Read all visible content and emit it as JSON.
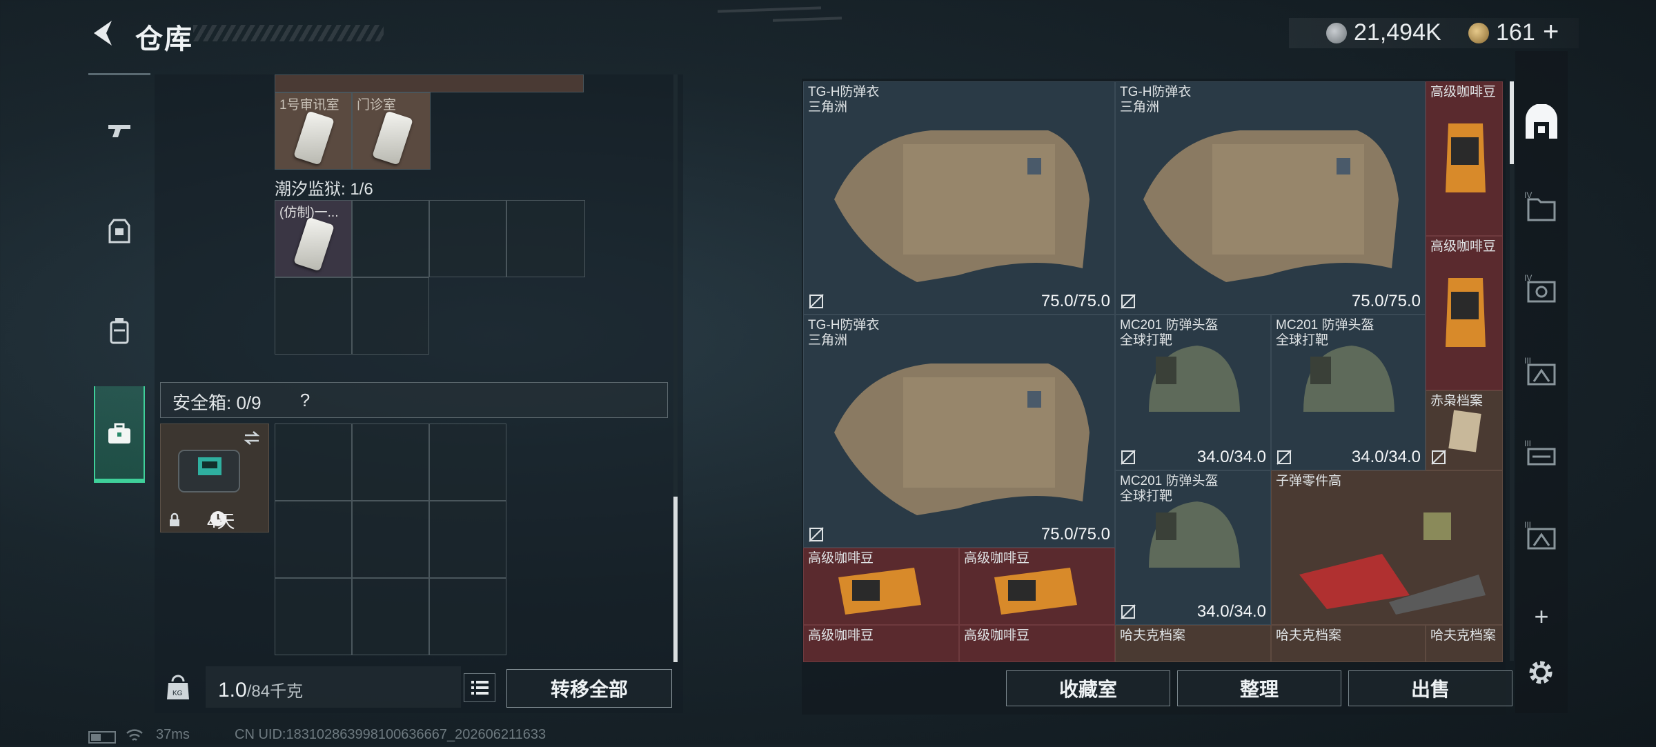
{
  "header": {
    "title": "仓库",
    "currency_1": "21,494K",
    "currency_2": "161",
    "plus": "+"
  },
  "storage": {
    "top_cells": [
      {
        "label": "1号审讯室"
      },
      {
        "label": "门诊室"
      }
    ],
    "prison_label": "潮汐监狱: 1/6",
    "prison_item": "(仿制)一...",
    "safe_label": "安全箱: 0/9",
    "safe_help": "?",
    "safe_time": "4天"
  },
  "bottom_left": {
    "weight": "1.0",
    "weight_max": "/84千克",
    "transfer_all": "转移全部"
  },
  "status": {
    "ping": "37ms",
    "uid": "CN UID:18310286399810063666​7_202606211633"
  },
  "stash": {
    "items": [
      {
        "name": "TG-H防弹衣",
        "sub": "三角洲",
        "dura": "75.0/75.0"
      },
      {
        "name": "TG-H防弹衣",
        "sub": "三角洲",
        "dura": "75.0/75.0"
      },
      {
        "name": "高级咖啡豆"
      },
      {
        "name": "高级咖啡豆"
      },
      {
        "name": "TG-H防弹衣",
        "sub": "三角洲",
        "dura": "75.0/75.0"
      },
      {
        "name": "MC201 防弹头盔",
        "sub": "全球打靶",
        "dura": "34.0/34.0"
      },
      {
        "name": "MC201 防弹头盔",
        "sub": "全球打靶",
        "dura": "34.0/34.0"
      },
      {
        "name": "赤枭档案"
      },
      {
        "name": "MC201 防弹头盔",
        "sub": "全球打靶",
        "dura": "34.0/34.0"
      },
      {
        "name": "子弹零件高"
      },
      {
        "name": "高级咖啡豆"
      },
      {
        "name": "高级咖啡豆"
      },
      {
        "name": "高级咖啡豆"
      },
      {
        "name": "高级咖啡豆"
      },
      {
        "name": "哈夫克档案"
      },
      {
        "name": "哈夫克档案"
      },
      {
        "name": "哈夫克档案"
      }
    ]
  },
  "sidebar_right": {
    "plus": "+",
    "tabs": [
      "home",
      "IV",
      "IV",
      "III",
      "III",
      "III"
    ]
  },
  "bottom_right": {
    "collection": "收藏室",
    "sort": "整理",
    "sell": "出售"
  },
  "colors": {
    "accent_green": "#3fd09a",
    "cell_blue": "#233340",
    "cell_red": "#5a2a2e",
    "cell_brown": "#4a3a32"
  }
}
